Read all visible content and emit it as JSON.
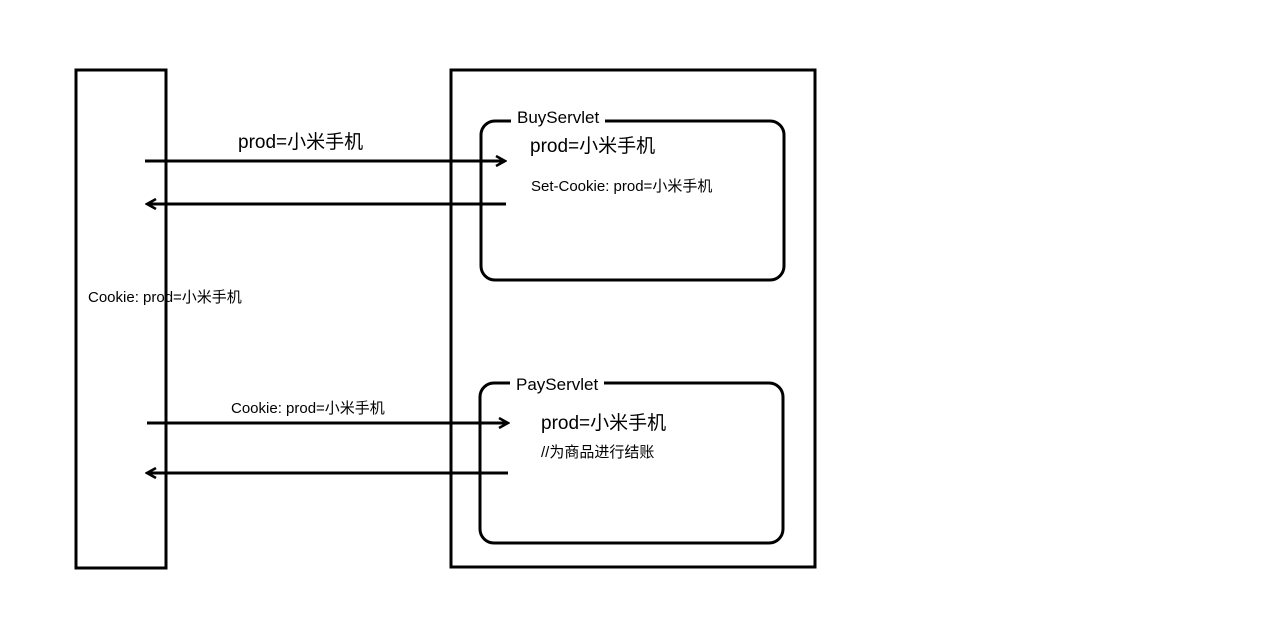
{
  "servlets": {
    "buy": {
      "title": "BuyServlet",
      "param": "prod=小米手机",
      "set_cookie": "Set-Cookie: prod=小米手机"
    },
    "pay": {
      "title": "PayServlet",
      "param": "prod=小米手机",
      "comment": "//为商品进行结账"
    }
  },
  "arrows": {
    "request_1": "prod=小米手机",
    "request_2": "Cookie: prod=小米手机"
  },
  "browser": {
    "cookie": "Cookie: prod=小米手机"
  }
}
